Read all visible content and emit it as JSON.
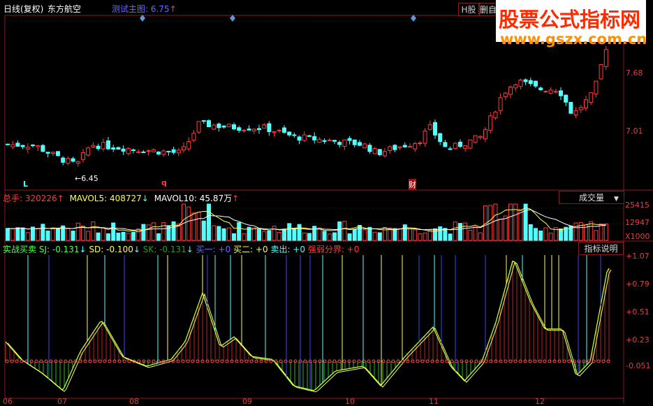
{
  "header": {
    "period": "日线(复权)",
    "stock": "东方航空",
    "main_formula": "测试主图: 6.75",
    "main_arrow": "↑",
    "h_share": "H股",
    "delete_btn": "删自"
  },
  "watermark": {
    "line1": "股票公式指标网",
    "line2": "www.gszx.com.cn"
  },
  "price_axis": [
    "7.68",
    "7.01"
  ],
  "price_marks": {
    "low_label": "←6.45",
    "marker_L": "L",
    "marker_q": "q",
    "marker_cai": "财"
  },
  "volume": {
    "total_label": "总手: 320226",
    "total_arrow": "↑",
    "mavol5_label": "MAVOL5: 408727",
    "mavol5_arrow": "↓",
    "mavol10_label": "MAVOL10: 45.87万",
    "mavol10_arrow": "↑",
    "selector": "成交量",
    "selector_arrow": "▼",
    "axis": [
      "25415",
      "12947",
      "X1000"
    ]
  },
  "indicator": {
    "name": "实战买卖",
    "sj": "SJ: -0.131",
    "sj_arrow": "↓",
    "sd": "SD: -0.100",
    "sd_arrow": "↓",
    "sk": "SK: -0.131",
    "sk_arrow": "↓",
    "buy1": "买一: +0",
    "buy2": "买二: +0",
    "sell": "卖出: +0",
    "boundary": "强弱分界: +0",
    "help_btn": "指标说明",
    "axis": [
      "+1.07",
      "+0.79",
      "+0.51",
      "+0.23",
      "-0.051"
    ]
  },
  "x_axis": [
    "06",
    "07",
    "08",
    "09",
    "10",
    "11",
    "12"
  ],
  "colors": {
    "up": "#ff3c3c",
    "down": "#54ffff",
    "frame": "#8a1a1a",
    "ma5": "#ffff54",
    "ma10": "#ffffff",
    "buy1": "#4040ff",
    "sell": "#54ffff"
  }
}
